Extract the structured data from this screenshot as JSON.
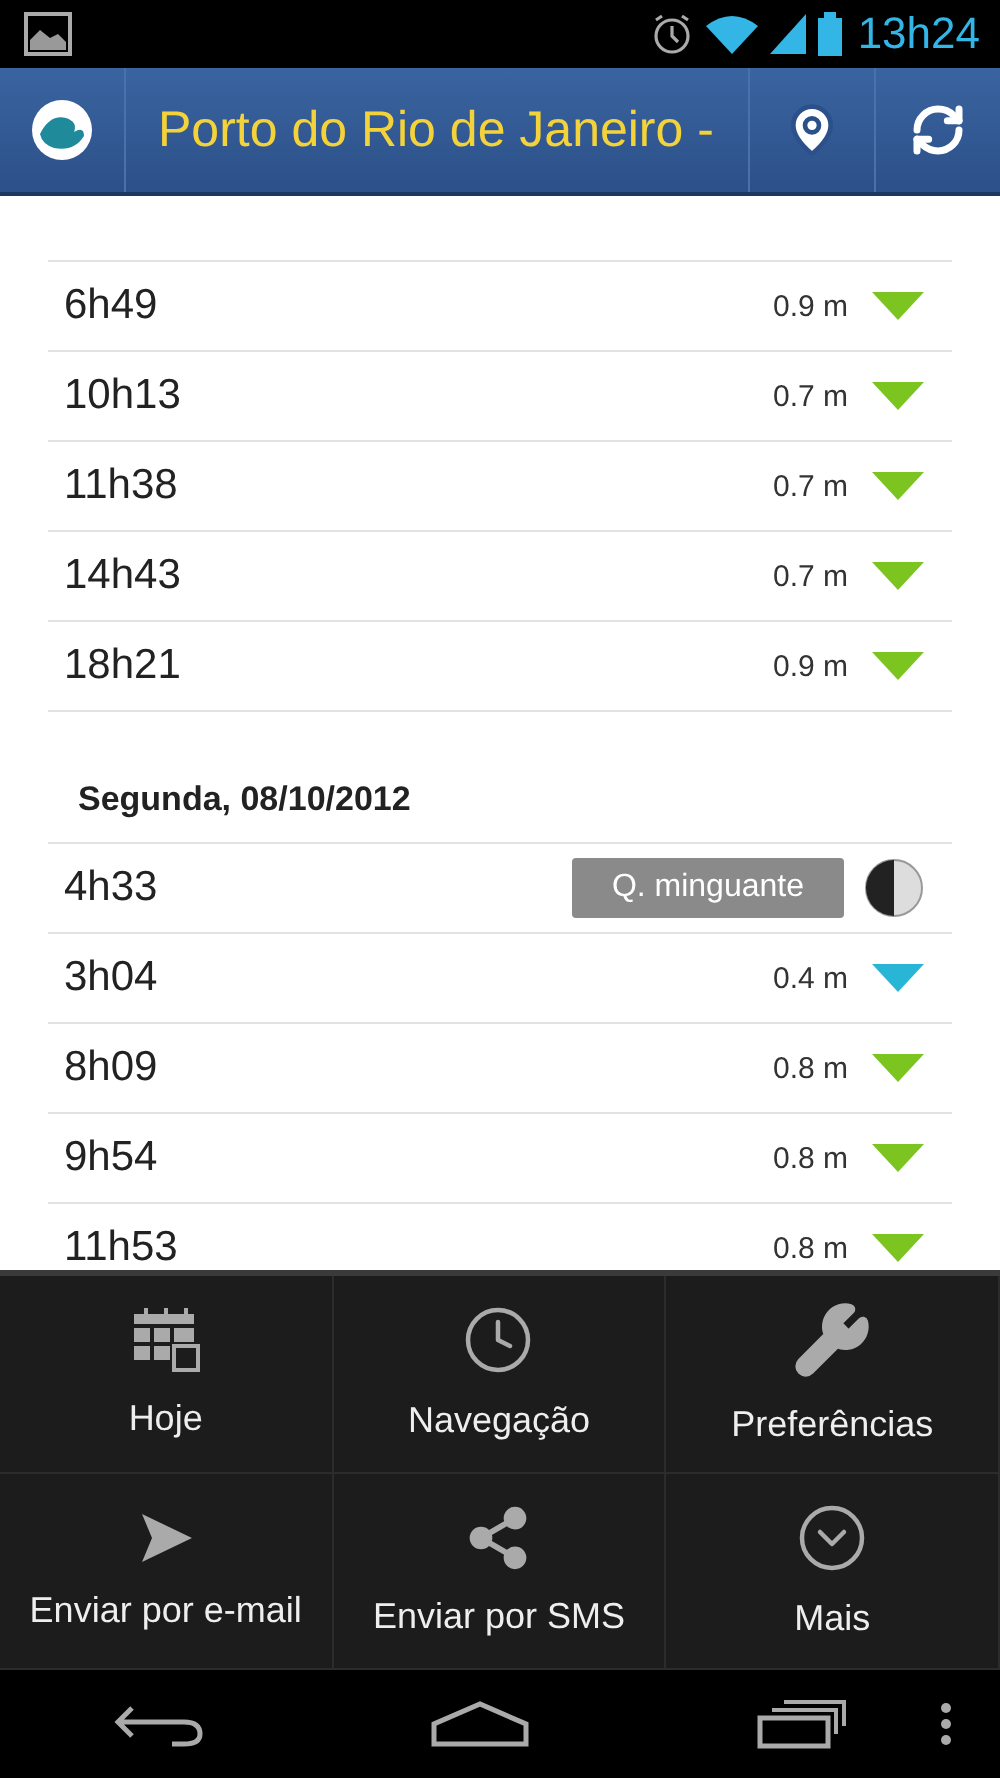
{
  "status_bar": {
    "time": "13h24"
  },
  "action_bar": {
    "title": "Porto do Rio de Janeiro -"
  },
  "days": [
    {
      "rows": [
        {
          "kind": "tide",
          "time": "6h49",
          "height": "0.9 m",
          "color": "#7cc520"
        },
        {
          "kind": "tide",
          "time": "10h13",
          "height": "0.7 m",
          "color": "#7cc520"
        },
        {
          "kind": "tide",
          "time": "11h38",
          "height": "0.7 m",
          "color": "#7cc520"
        },
        {
          "kind": "tide",
          "time": "14h43",
          "height": "0.7 m",
          "color": "#7cc520"
        },
        {
          "kind": "tide",
          "time": "18h21",
          "height": "0.9 m",
          "color": "#7cc520"
        }
      ]
    },
    {
      "heading": "Segunda, 08/10/2012",
      "rows": [
        {
          "kind": "moon",
          "time": "4h33",
          "phase": "Q. minguante"
        },
        {
          "kind": "tide",
          "time": "3h04",
          "height": "0.4 m",
          "color": "#29b6d6"
        },
        {
          "kind": "tide",
          "time": "8h09",
          "height": "0.8 m",
          "color": "#7cc520"
        },
        {
          "kind": "tide",
          "time": "9h54",
          "height": "0.8 m",
          "color": "#7cc520"
        },
        {
          "kind": "tide",
          "time": "11h53",
          "height": "0.8 m",
          "color": "#7cc520"
        }
      ]
    }
  ],
  "menu": {
    "items": [
      {
        "label": "Hoje"
      },
      {
        "label": "Navegação"
      },
      {
        "label": "Preferências"
      },
      {
        "label": "Enviar por e-mail"
      },
      {
        "label": "Enviar por SMS"
      },
      {
        "label": "Mais"
      }
    ]
  }
}
